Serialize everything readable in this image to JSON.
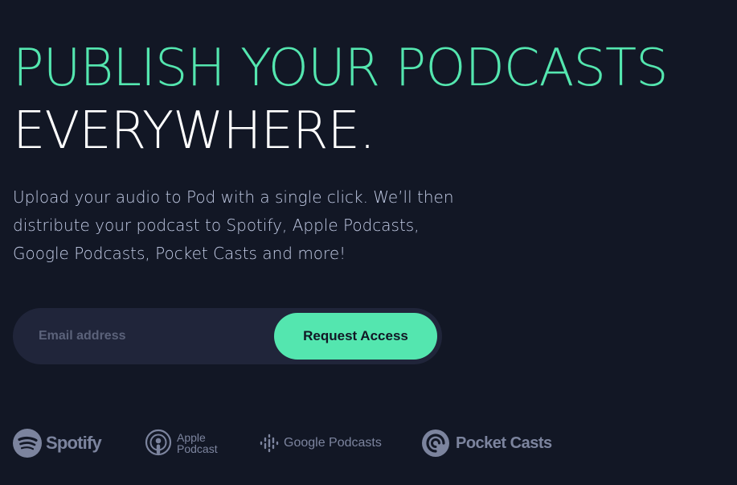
{
  "hero": {
    "headline_accent": "PUBLISH YOUR PODCASTS",
    "headline_plain": "EVERYWHERE.",
    "intro": "Upload your audio to Pod with a single click. We’ll then distribute your podcast to Spotify, Apple Podcasts, Google Podcasts, Pocket Casts and more!"
  },
  "signup": {
    "email_placeholder": "Email address",
    "email_value": "",
    "submit_label": "Request Access"
  },
  "platforms": [
    {
      "name": "Spotify",
      "icon": "spotify-icon"
    },
    {
      "name": "Apple Podcast",
      "icon": "apple-podcasts-icon"
    },
    {
      "name": "Google Podcasts",
      "icon": "google-podcasts-icon"
    },
    {
      "name": "Pocket Casts",
      "icon": "pocket-casts-icon"
    }
  ],
  "colors": {
    "background": "#121725",
    "accent": "#54E6AF",
    "text_light": "#FFFFFF",
    "body_text": "#C2CBE5",
    "input_bg": "#20253A",
    "logo_gray": "#7C849E"
  }
}
